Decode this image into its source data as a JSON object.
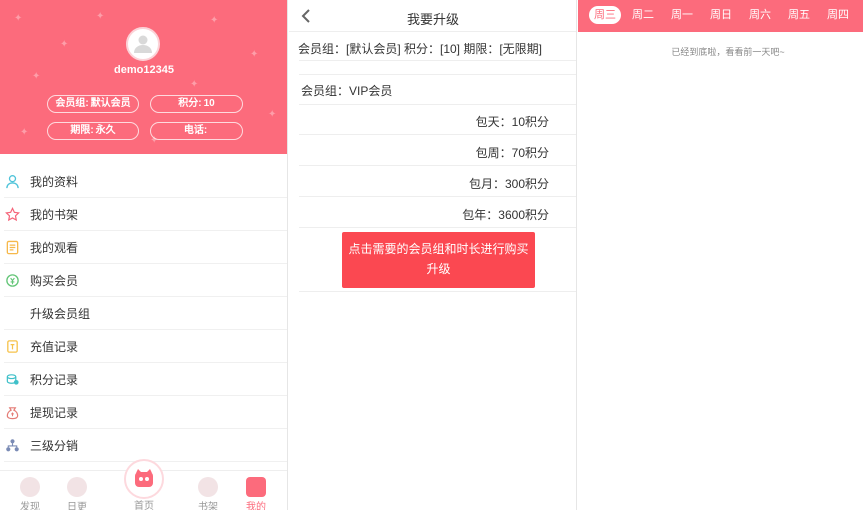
{
  "profile": {
    "username": "demo12345",
    "member_group_label": "会员组:",
    "member_group_value": "默认会员",
    "points_label": "积分:",
    "points_value": "10",
    "expiry_label": "期限:",
    "expiry_value": "永久",
    "phone_label": "电话:",
    "phone_value": "",
    "accent_color": "#fc6b7c"
  },
  "menu": {
    "items": [
      {
        "label": "我的资料",
        "icon": "user-icon"
      },
      {
        "label": "我的书架",
        "icon": "star-icon"
      },
      {
        "label": "我的观看",
        "icon": "document-icon"
      },
      {
        "label": "购买会员",
        "icon": "money-icon"
      },
      {
        "label": "升级会员组",
        "icon": ""
      },
      {
        "label": "充值记录",
        "icon": "wallet-icon"
      },
      {
        "label": "积分记录",
        "icon": "coins-icon"
      },
      {
        "label": "提现记录",
        "icon": "bag-icon"
      },
      {
        "label": "三级分销",
        "icon": "network-icon"
      }
    ]
  },
  "tabbar": {
    "discover": "发现",
    "updates": "日更",
    "home": "首页",
    "bookshelf": "书架",
    "mine": "我的"
  },
  "upgrade": {
    "title": "我要升级",
    "current_info": "会员组：[默认会员] 积分：[10] 期限：[无限期]",
    "group_line": "会员组：VIP会员",
    "prices": [
      "包天：10积分",
      "包周：70积分",
      "包月：300积分",
      "包年：3600积分"
    ],
    "button_label": "点击需要的会员组和时长进行购买升级"
  },
  "schedule": {
    "days": [
      "周三",
      "周二",
      "周一",
      "周日",
      "周六",
      "周五",
      "周四"
    ],
    "active_day": "周三",
    "empty_note": "已经到底啦，看看前一天吧~"
  }
}
